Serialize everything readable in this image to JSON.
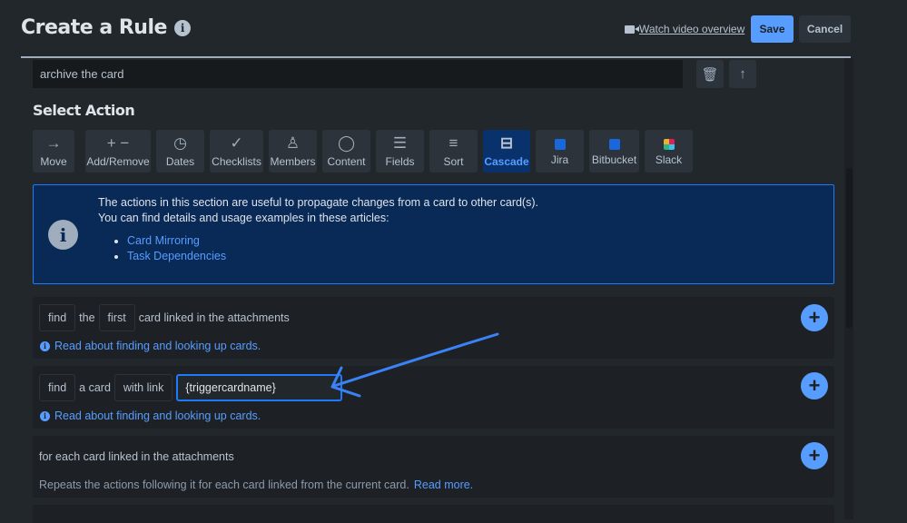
{
  "header": {
    "title": "Create a Rule",
    "video_link": "Watch video overview",
    "save": "Save",
    "cancel": "Cancel"
  },
  "previous_action": {
    "text": "archive the card"
  },
  "select_action": {
    "heading": "Select Action",
    "tabs": [
      {
        "label": "Move",
        "icon": "arrow-right-icon"
      },
      {
        "label": "Add/Remove",
        "icon": "plus-minus-icon"
      },
      {
        "label": "Dates",
        "icon": "clock-icon"
      },
      {
        "label": "Checklists",
        "icon": "check-icon"
      },
      {
        "label": "Members",
        "icon": "person-icon"
      },
      {
        "label": "Content",
        "icon": "comment-icon"
      },
      {
        "label": "Fields",
        "icon": "lines-icon"
      },
      {
        "label": "Sort",
        "icon": "filter-icon"
      },
      {
        "label": "Cascade",
        "icon": "inbox-icon",
        "selected": true
      },
      {
        "label": "Jira",
        "icon": "jira-icon"
      },
      {
        "label": "Bitbucket",
        "icon": "bitbucket-icon"
      },
      {
        "label": "Slack",
        "icon": "slack-icon"
      }
    ]
  },
  "info": {
    "line1": "The actions in this section are useful to propagate changes from a card to other card(s).",
    "line2": "You can find details and usage examples in these articles:",
    "links": [
      "Card Mirroring",
      "Task Dependencies"
    ]
  },
  "rows": [
    {
      "find": "find",
      "the": "the",
      "first": "first",
      "rest": "card linked in the attachments",
      "help": "Read about finding and looking up cards."
    },
    {
      "find": "find",
      "acard": "a card",
      "withlink": "with link",
      "value": "{triggercardname}",
      "help": "Read about finding and looking up cards."
    },
    {
      "text": "for each card linked in the attachments",
      "desc": "Repeats the actions following it for each card linked from the current card.",
      "more": "Read more."
    }
  ],
  "colors": {
    "accent": "#579dff",
    "selected_bg": "#09326c",
    "annotation_arrow": "#3b82f6"
  }
}
